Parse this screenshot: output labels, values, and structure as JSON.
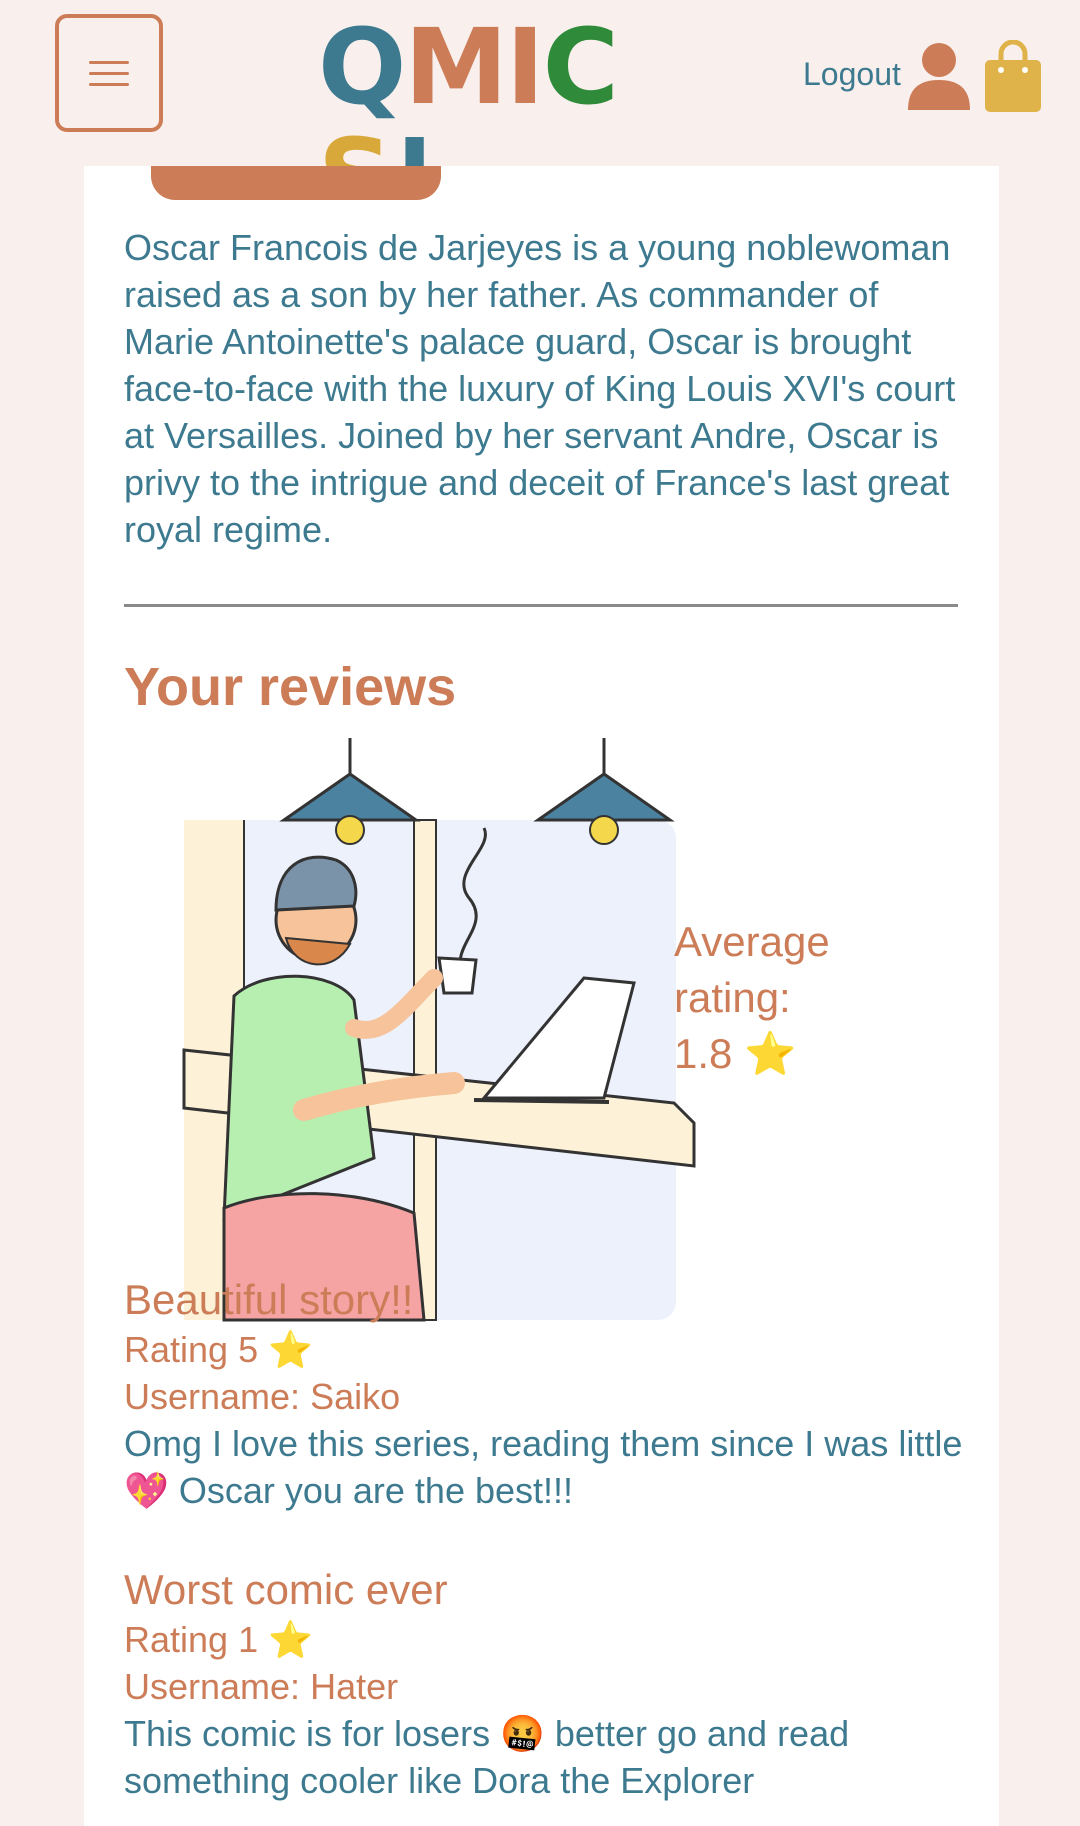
{
  "header": {
    "logo": [
      "Q",
      "M",
      "I",
      "C",
      "S",
      "!"
    ],
    "logo_colors": [
      "#3d7a8f",
      "#cc7d58",
      "#cc7d58",
      "#2f8a3a",
      "#cc7d58",
      "#3d7a8f"
    ],
    "logout_label": "Logout",
    "icons": [
      "menu-icon",
      "user-icon",
      "shopping-bag-icon"
    ]
  },
  "description": "Oscar Francois de Jarjeyes is a young noblewoman raised as a son by her father. As commander of Marie Antoinette's palace guard, Oscar is brought face-to-face with the luxury of King Louis XVI's court at Versailles. Joined by her servant Andre, Oscar is privy to the intrigue and deceit of France's last great royal regime.",
  "reviews_section": {
    "title": "Your reviews",
    "average_label": "Average rating:",
    "average_value": "1.8 ⭐"
  },
  "reviews": [
    {
      "title": "Beautiful story!!",
      "rating": "Rating 5 ⭐",
      "username": "Username: Saiko",
      "body": "Omg I love this series, reading them since I was little 💖 Oscar you are the best!!!"
    },
    {
      "title": "Worst comic ever",
      "rating": "Rating 1 ⭐",
      "username": "Username: Hater",
      "body": "This comic is for losers 🤬 better go and read something cooler like Dora the Explorer"
    }
  ],
  "colors": {
    "accent": "#cc7d58",
    "text": "#3d7a8f",
    "background": "#f9f0ed"
  }
}
